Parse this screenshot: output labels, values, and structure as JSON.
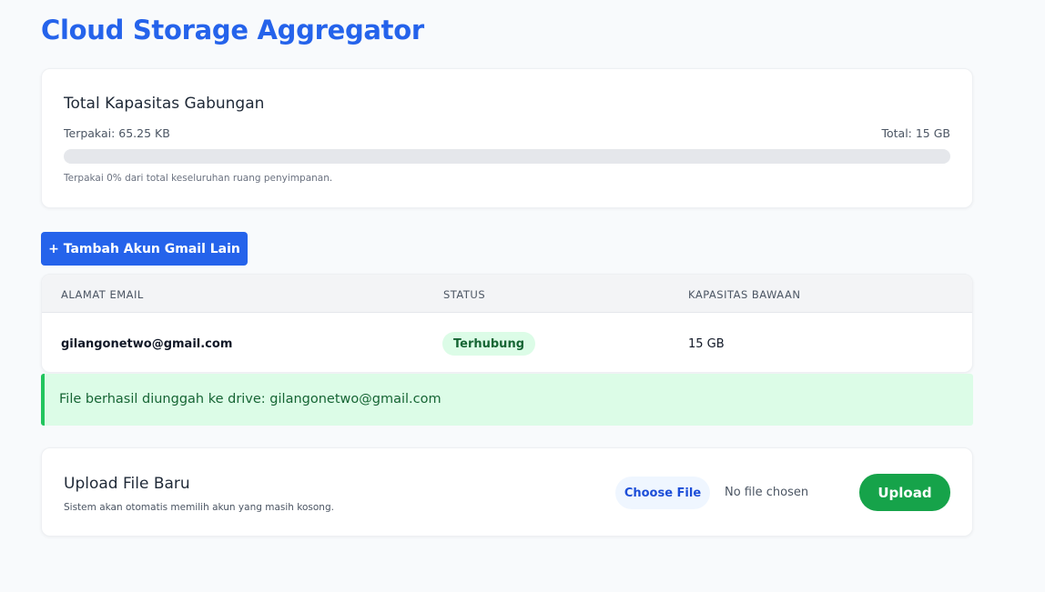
{
  "page": {
    "title": "Cloud Storage Aggregator"
  },
  "capacity": {
    "title": "Total Kapasitas Gabungan",
    "used_label": "Terpakai: 65.25 KB",
    "total_label": "Total: 15 GB",
    "progress_percent": 0,
    "note": "Terpakai 0% dari total keseluruhan ruang penyimpanan."
  },
  "actions": {
    "add_account_label": "+ Tambah Akun Gmail Lain"
  },
  "accounts_table": {
    "headers": [
      "ALAMAT EMAIL",
      "STATUS",
      "KAPASITAS BAWAAN"
    ],
    "rows": [
      {
        "email": "gilangonetwo@gmail.com",
        "status": "Terhubung",
        "capacity": "15 GB"
      }
    ]
  },
  "alert": {
    "message": "File berhasil diunggah ke drive: gilangonetwo@gmail.com"
  },
  "upload": {
    "title": "Upload File Baru",
    "note": "Sistem akan otomatis memilih akun yang masih kosong.",
    "choose_label": "Choose File",
    "file_status": "No file chosen",
    "upload_label": "Upload"
  },
  "colors": {
    "primary": "#2563eb",
    "success": "#16a34a",
    "success_bg": "#dcfce7",
    "success_text": "#166534"
  }
}
